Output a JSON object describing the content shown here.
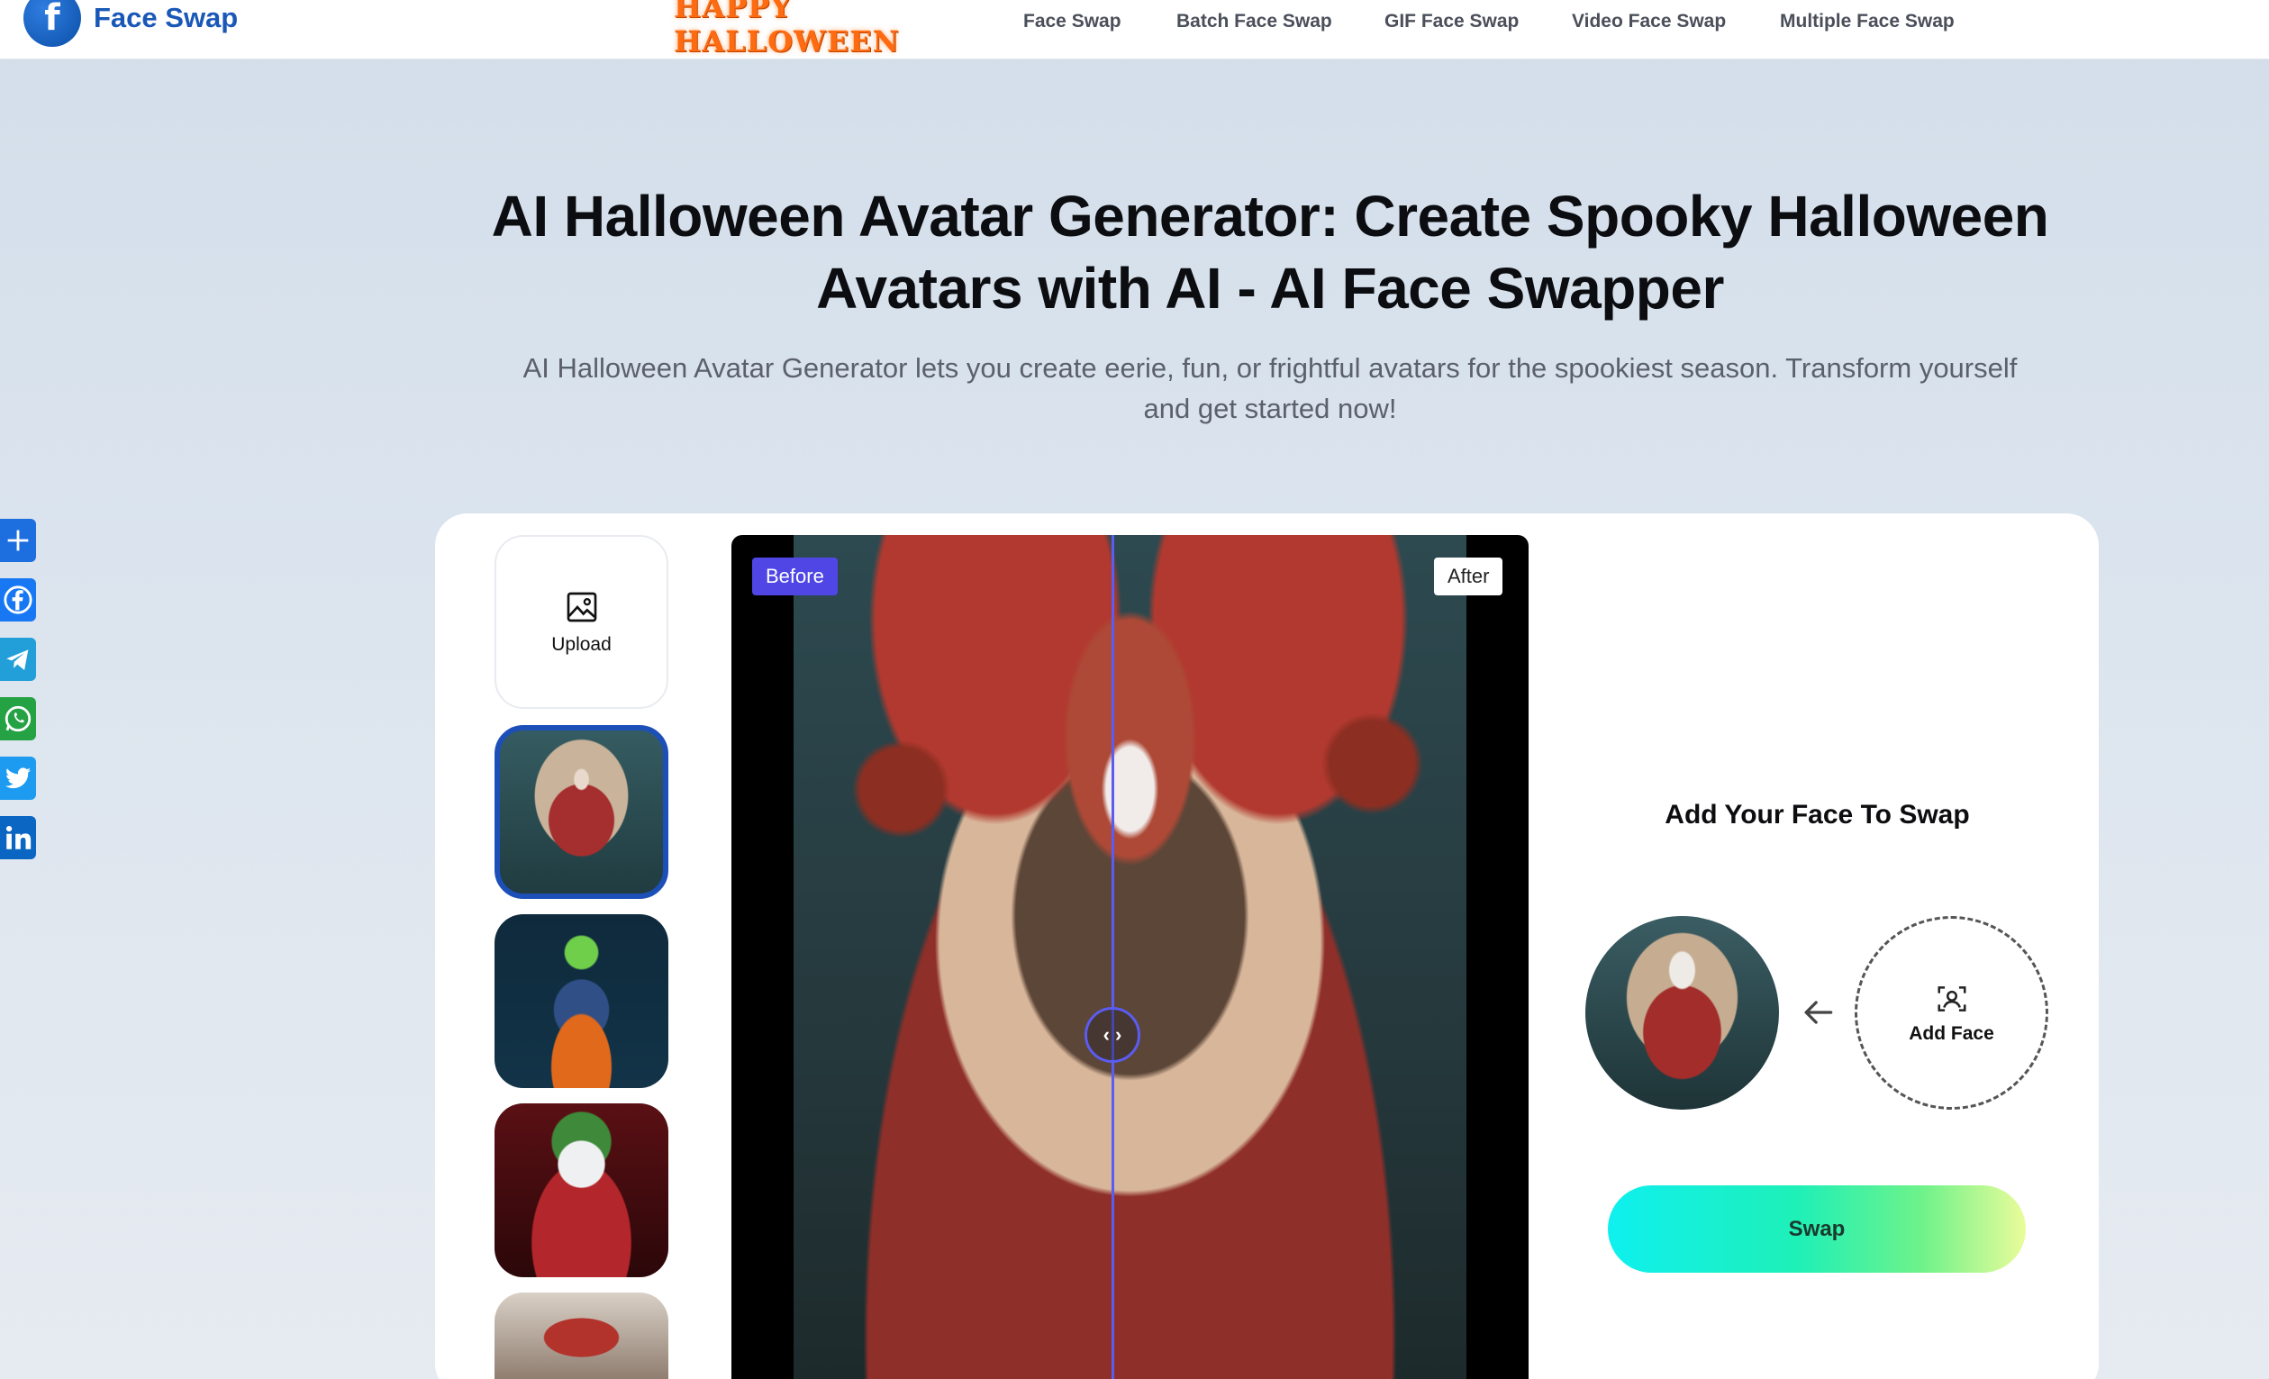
{
  "header": {
    "logo_text": "Face Swap",
    "banner_text": "HAPPY HALLOWEEN",
    "nav": [
      "Face Swap",
      "Batch Face Swap",
      "GIF Face Swap",
      "Video Face Swap",
      "Multiple Face Swap"
    ]
  },
  "hero": {
    "title": "AI Halloween Avatar Generator: Create Spooky Halloween Avatars with AI - AI Face Swapper",
    "subtitle": "AI Halloween Avatar Generator lets you create eerie, fun, or frightful avatars for the spookiest season. Transform yourself and get started now!"
  },
  "share_icons": [
    "share-plus-icon",
    "facebook-icon",
    "telegram-icon",
    "whatsapp-icon",
    "twitter-icon",
    "linkedin-icon"
  ],
  "templates": {
    "upload_label": "Upload"
  },
  "viewer": {
    "before_label": "Before",
    "after_label": "After"
  },
  "panel": {
    "title": "Add Your Face To Swap",
    "add_face_label": "Add Face",
    "swap_label": "Swap"
  },
  "colors": {
    "accent": "#4f46e5",
    "brand": "#1a58b8",
    "selected_border": "#1d4fb8"
  }
}
